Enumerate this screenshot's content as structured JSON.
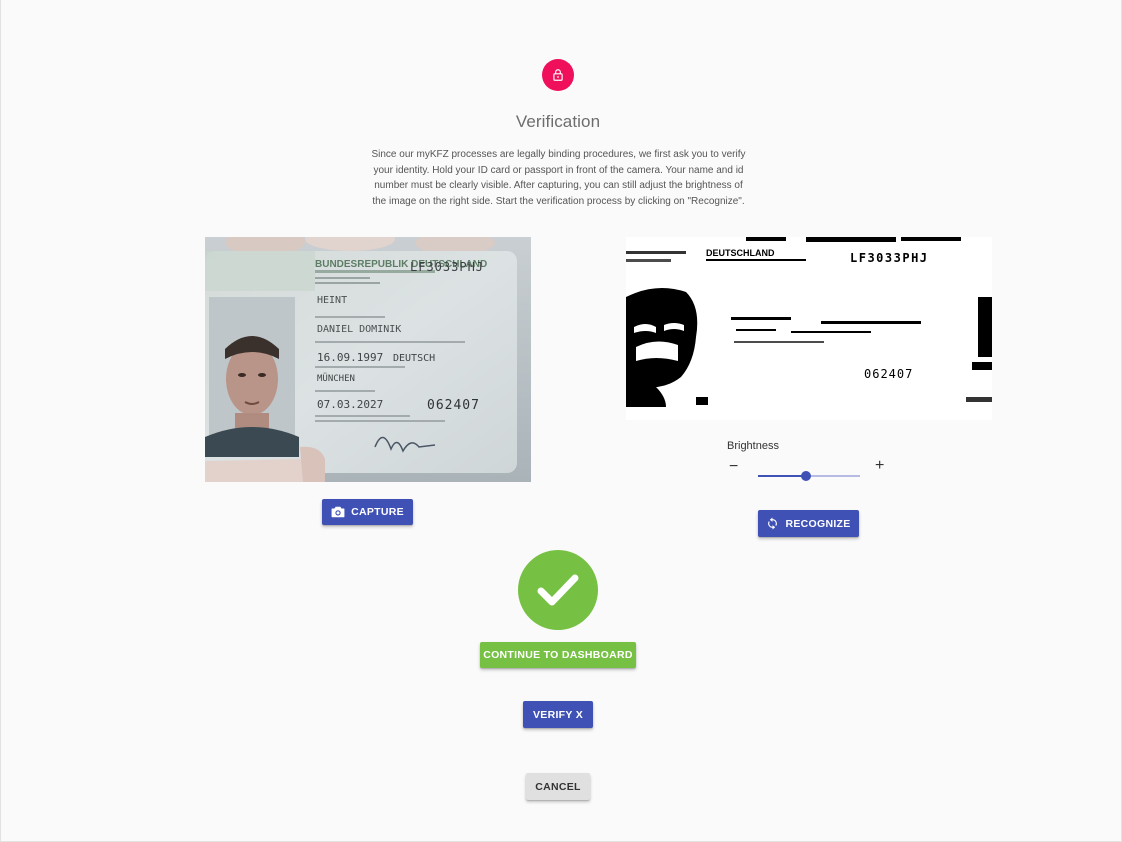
{
  "header": {
    "icon": "lock-icon",
    "accent_color": "#ef0f5a",
    "title": "Verification",
    "description": "Since our myKFZ processes are legally binding procedures, we first ask you to verify your identity. Hold your ID card or passport in front of the camera. Your name and id number must be clearly visible. After capturing, you can still adjust the brightness of the image on the right side. Start the verification process by clicking on \"Recognize\"."
  },
  "camera": {
    "id_card": {
      "header": "BUNDESREPUBLIK DEUTSCHLAND",
      "doc_number": "LF3033PHJ",
      "surname": "HEINT",
      "given_names": "DANIEL DOMINIK",
      "birth_date": "16.09.1997",
      "nationality": "DEUTSCH",
      "birth_place": "MÜNCHEN",
      "expiry": "07.03.2027",
      "can_number": "062407"
    },
    "capture_label": "Capture",
    "capture_icon": "camera-icon"
  },
  "processed": {
    "header": "DEUTSCHLAND",
    "doc_number": "LF3033PHJ",
    "can_number": "062407"
  },
  "brightness": {
    "label": "Brightness",
    "minus": "−",
    "plus": "+",
    "value_fraction": 0.47
  },
  "recognize": {
    "label": "Recognize",
    "icon": "sync-icon"
  },
  "status": {
    "icon": "checkmark-icon",
    "color": "#76c043"
  },
  "actions": {
    "continue_label": "Continue to Dashboard",
    "verify_label": "Verify X",
    "cancel_label": "Cancel"
  },
  "colors": {
    "primary": "#3f51b5",
    "success": "#76c043",
    "accent": "#ef0f5a"
  }
}
